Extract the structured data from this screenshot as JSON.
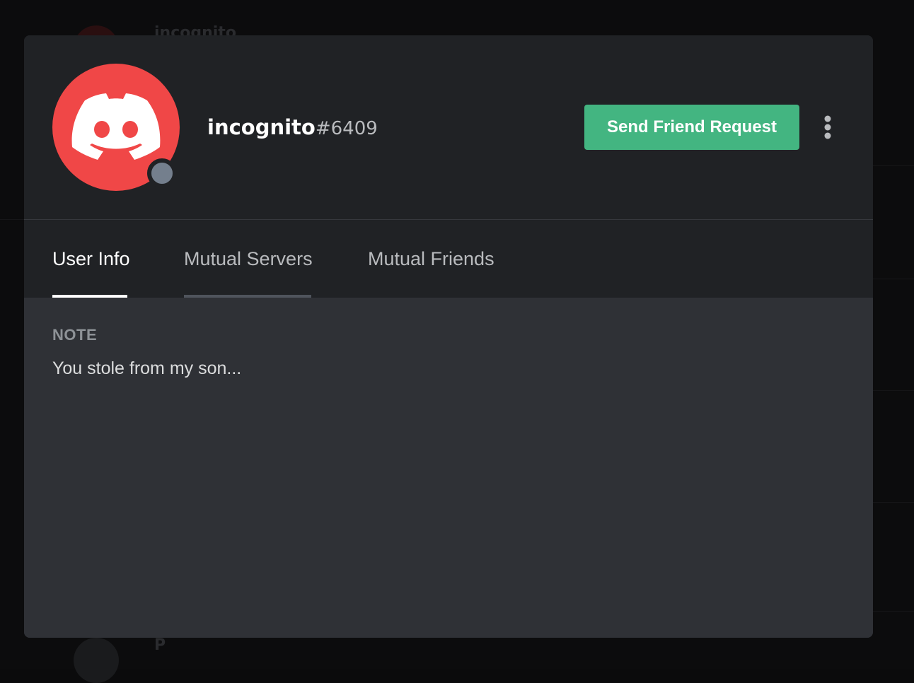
{
  "profile": {
    "username": "incognito",
    "discriminator": "#6409",
    "avatar_color": "#f04747",
    "avatar_icon": "discord-logo-icon",
    "status": "offline",
    "status_color": "#747f8d"
  },
  "actions": {
    "send_friend_request_label": "Send Friend Request",
    "send_friend_request_color": "#43b581",
    "more_icon": "vertical-ellipsis-icon"
  },
  "tabs": [
    {
      "label": "User Info",
      "active": true
    },
    {
      "label": "Mutual Servers",
      "active": false
    },
    {
      "label": "Mutual Friends",
      "active": false
    }
  ],
  "note": {
    "label": "NOTE",
    "value": "You stole from my son..."
  },
  "background": {
    "top_name": "incognito",
    "bottom_name": "P"
  }
}
